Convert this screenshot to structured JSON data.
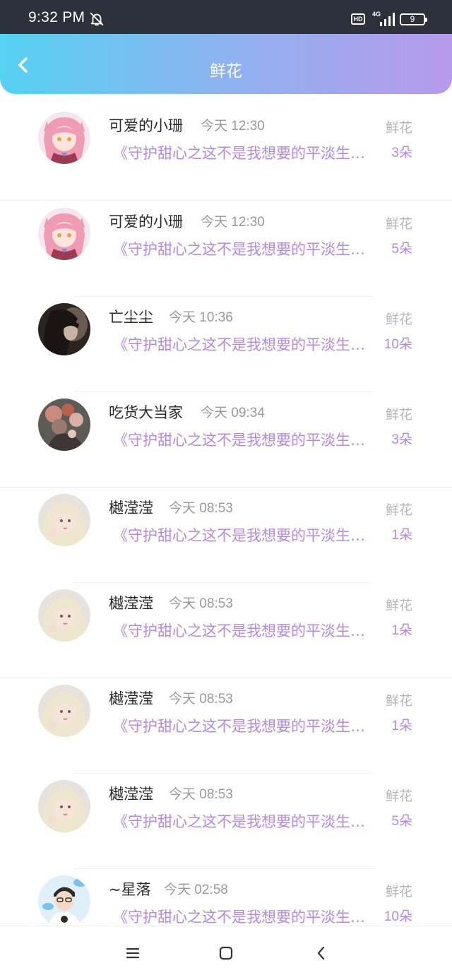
{
  "status_bar": {
    "time": "9:32 PM",
    "hd_label": "HD",
    "network": "4G",
    "battery": "9",
    "icons": [
      "bell-off-icon",
      "signal-icon",
      "battery-icon"
    ]
  },
  "header": {
    "title": "鲜花",
    "back_icon": "chevron-left-icon",
    "gradient": [
      "#56d2f3",
      "#b79aeb"
    ]
  },
  "colors": {
    "accent_purple": "#b489e0",
    "name_text": "#2b2b2b",
    "muted_text": "#9a9a9a"
  },
  "records": [
    {
      "name": "可爱的小珊",
      "time": "今天 12:30",
      "book": "《守护甜心之这不是我想要的平淡生活》",
      "gift": "鲜花",
      "count": "3朵",
      "avatar": "pink-hair-anime-avatar"
    },
    {
      "name": "可爱的小珊",
      "time": "今天 12:30",
      "book": "《守护甜心之这不是我想要的平淡生活》",
      "gift": "鲜花",
      "count": "5朵",
      "avatar": "pink-hair-anime-avatar"
    },
    {
      "name": "亡尘尘",
      "time": "今天 10:36",
      "book": "《守护甜心之这不是我想要的平淡生活》",
      "gift": "鲜花",
      "count": "10朵",
      "avatar": "dark-photo-avatar"
    },
    {
      "name": "吃货大当家",
      "time": "今天 09:34",
      "book": "《守护甜心之这不是我想要的平淡生活》",
      "gift": "鲜花",
      "count": "3朵",
      "avatar": "flowers-photo-avatar"
    },
    {
      "name": "樾滢滢",
      "time": "今天 08:53",
      "book": "《守护甜心之这不是我想要的平淡生活》",
      "gift": "鲜花",
      "count": "1朵",
      "avatar": "blonde-girl-avatar"
    },
    {
      "name": "樾滢滢",
      "time": "今天 08:53",
      "book": "《守护甜心之这不是我想要的平淡生活》",
      "gift": "鲜花",
      "count": "1朵",
      "avatar": "blonde-girl-avatar"
    },
    {
      "name": "樾滢滢",
      "time": "今天 08:53",
      "book": "《守护甜心之这不是我想要的平淡生活》",
      "gift": "鲜花",
      "count": "1朵",
      "avatar": "blonde-girl-avatar"
    },
    {
      "name": "樾滢滢",
      "time": "今天 08:53",
      "book": "《守护甜心之这不是我想要的平淡生活》",
      "gift": "鲜花",
      "count": "5朵",
      "avatar": "blonde-girl-avatar"
    },
    {
      "name": "~星落",
      "time": "今天 02:58",
      "book": "《守护甜心之这不是我想要的平淡生活》",
      "gift": "鲜花",
      "count": "10朵",
      "avatar": "boy-cartoon-avatar"
    }
  ],
  "nav_bar": {
    "icons": [
      "menu-icon",
      "home-square-icon",
      "back-triangle-icon"
    ]
  }
}
